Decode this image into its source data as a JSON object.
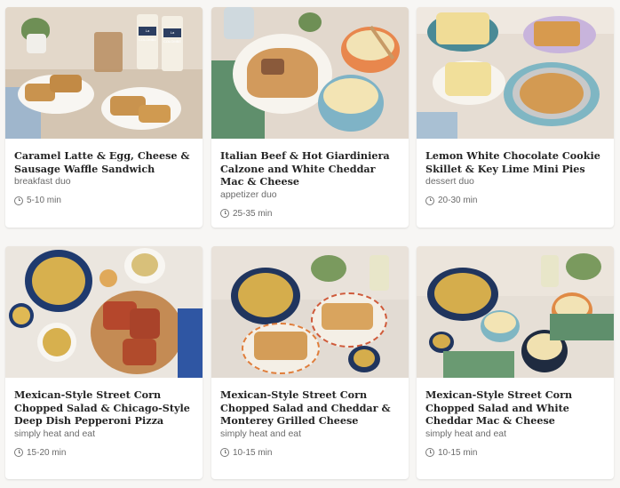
{
  "cards": [
    {
      "title": "Caramel Latte & Egg, Cheese & Sausage Waffle Sandwich",
      "subtitle": "breakfast duo",
      "time": "5-10 min",
      "brand_text": "La COLOMBE"
    },
    {
      "title": "Italian Beef & Hot Giardiniera Calzone and White Cheddar Mac & Cheese",
      "subtitle": "appetizer duo",
      "time": "25-35 min"
    },
    {
      "title": "Lemon White Chocolate Cookie Skillet & Key Lime Mini Pies",
      "subtitle": "dessert duo",
      "time": "20-30 min"
    },
    {
      "title": "Mexican-Style Street Corn Chopped Salad & Chicago-Style Deep Dish Pepperoni Pizza",
      "subtitle": "simply heat and eat",
      "time": "15-20 min"
    },
    {
      "title": "Mexican-Style Street Corn Chopped Salad and Cheddar & Monterey Grilled Cheese",
      "subtitle": "simply heat and eat",
      "time": "10-15 min"
    },
    {
      "title": "Mexican-Style Street Corn Chopped Salad and White Cheddar Mac & Cheese",
      "subtitle": "simply heat and eat",
      "time": "10-15 min"
    }
  ],
  "icons": {
    "time": "clock-icon"
  },
  "colors": {
    "page_bg": "#f7f6f4",
    "card_bg": "#ffffff",
    "title": "#242424",
    "meta": "#6b6b6b"
  }
}
